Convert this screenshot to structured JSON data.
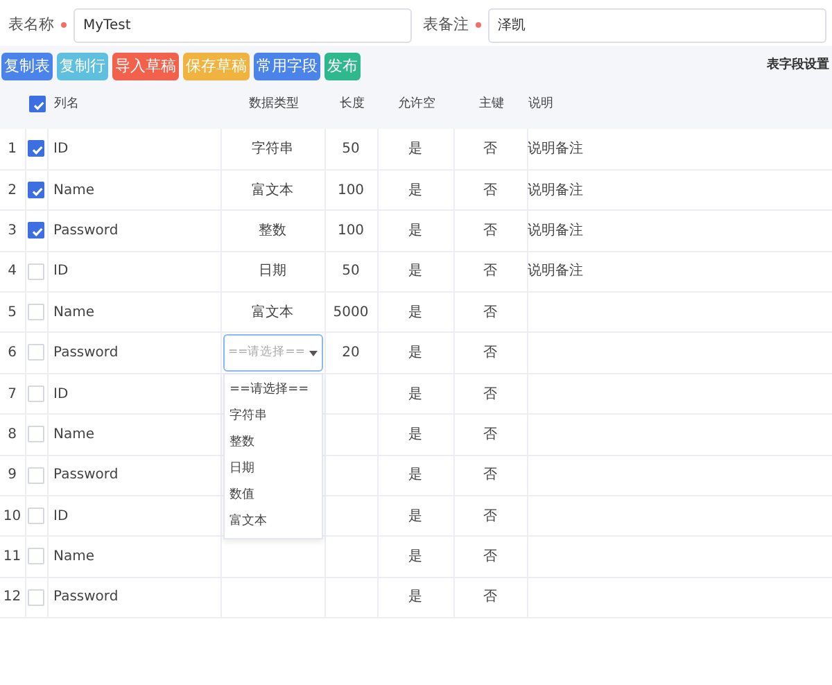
{
  "form": {
    "fields": [
      {
        "label": "表名称",
        "required": true,
        "value": "MyTest"
      },
      {
        "label": "表备注",
        "required": true,
        "value": "泽凯"
      }
    ]
  },
  "toolbar": {
    "buttons": [
      {
        "label": "复制表",
        "color": "#4a84ea"
      },
      {
        "label": "复制行",
        "color": "#5ebfdf"
      },
      {
        "label": "导入草稿",
        "color": "#f2614b"
      },
      {
        "label": "保存草稿",
        "color": "#f1b33f"
      },
      {
        "label": "常用字段",
        "color": "#4a84ea"
      },
      {
        "label": "发布",
        "color": "#2fb88c"
      }
    ],
    "settings_link": "表字段设置"
  },
  "table": {
    "select_all_checked": true,
    "columns": [
      "列名",
      "数据类型",
      "长度",
      "允许空",
      "主键",
      "说明"
    ],
    "rows": [
      {
        "index": "1",
        "checked": true,
        "name": "ID",
        "type": "字符串",
        "length": "50",
        "nullable": "是",
        "primary_key": "否",
        "description": "说明备注"
      },
      {
        "index": "2",
        "checked": true,
        "name": "Name",
        "type": "富文本",
        "length": "100",
        "nullable": "是",
        "primary_key": "否",
        "description": "说明备注"
      },
      {
        "index": "3",
        "checked": true,
        "name": "Password",
        "type": "整数",
        "length": "100",
        "nullable": "是",
        "primary_key": "否",
        "description": "说明备注"
      },
      {
        "index": "4",
        "checked": false,
        "name": "ID",
        "type": "日期",
        "length": "50",
        "nullable": "是",
        "primary_key": "否",
        "description": "说明备注"
      },
      {
        "index": "5",
        "checked": false,
        "name": "Name",
        "type": "富文本",
        "length": "5000",
        "nullable": "是",
        "primary_key": "否"
      },
      {
        "index": "6",
        "checked": false,
        "name": "Password",
        "type_select": {
          "placeholder": "==请选择==",
          "expanded": true,
          "options": [
            "==请选择==",
            "字符串",
            "整数",
            "日期",
            "数值",
            "富文本"
          ]
        },
        "length": "20",
        "nullable": "是",
        "primary_key": "否"
      },
      {
        "index": "7",
        "checked": false,
        "name": "ID",
        "nullable": "是",
        "primary_key": "否"
      },
      {
        "index": "8",
        "checked": false,
        "name": "Name",
        "nullable": "是",
        "primary_key": "否"
      },
      {
        "index": "9",
        "checked": false,
        "name": "Password",
        "nullable": "是",
        "primary_key": "否"
      },
      {
        "index": "10",
        "checked": false,
        "name": "ID",
        "nullable": "是",
        "primary_key": "否"
      },
      {
        "index": "11",
        "checked": false,
        "name": "Name",
        "nullable": "是",
        "primary_key": "否"
      },
      {
        "index": "12",
        "checked": false,
        "name": "Password",
        "nullable": "是",
        "primary_key": "否"
      }
    ]
  }
}
